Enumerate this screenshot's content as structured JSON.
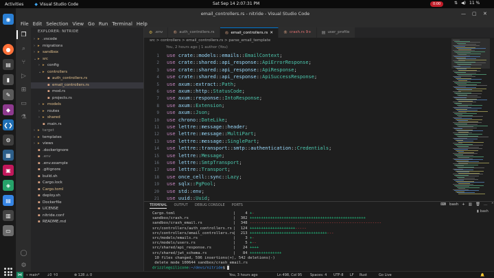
{
  "system": {
    "activities": "Activities",
    "app_name": "Visual Studio Code",
    "clock": "Sat Sep 14  2:07:31 PM",
    "record_time": "0:00",
    "battery": "11 %"
  },
  "window": {
    "title": "email_controllers.rs - nitride - Visual Studio Code"
  },
  "menu": [
    "File",
    "Edit",
    "Selection",
    "View",
    "Go",
    "Run",
    "Terminal",
    "Help"
  ],
  "sidebar": {
    "header": "EXPLORER: NITRIDE",
    "tree": [
      {
        "label": ".vscode",
        "depth": 1,
        "kind": "folder",
        "open": false,
        "color": "normal",
        "badge": ""
      },
      {
        "label": "migrations",
        "depth": 1,
        "kind": "folder",
        "open": false,
        "color": "normal",
        "badge": ""
      },
      {
        "label": "sandbox",
        "depth": 1,
        "kind": "folder",
        "open": false,
        "color": "mod",
        "badge": ""
      },
      {
        "label": "src",
        "depth": 1,
        "kind": "folder",
        "open": true,
        "color": "mod",
        "badge": ""
      },
      {
        "label": "config",
        "depth": 2,
        "kind": "folder",
        "open": false,
        "color": "normal",
        "badge": ""
      },
      {
        "label": "controllers",
        "depth": 2,
        "kind": "folder",
        "open": true,
        "color": "mod",
        "badge": ""
      },
      {
        "label": "auth_controllers.rs",
        "depth": 3,
        "kind": "file",
        "color": "mod",
        "badge": ""
      },
      {
        "label": "email_controllers.rs",
        "depth": 3,
        "kind": "file",
        "color": "mod",
        "badge": "",
        "selected": true
      },
      {
        "label": "mod.rs",
        "depth": 3,
        "kind": "file",
        "color": "normal",
        "badge": ""
      },
      {
        "label": "projects.rs",
        "depth": 3,
        "kind": "file",
        "color": "normal",
        "badge": ""
      },
      {
        "label": "models",
        "depth": 2,
        "kind": "folder",
        "open": false,
        "color": "mod",
        "badge": ""
      },
      {
        "label": "routes",
        "depth": 2,
        "kind": "folder",
        "open": false,
        "color": "normal",
        "badge": ""
      },
      {
        "label": "shared",
        "depth": 2,
        "kind": "folder",
        "open": false,
        "color": "mod",
        "badge": ""
      },
      {
        "label": "main.rs",
        "depth": 2,
        "kind": "file",
        "color": "normal",
        "badge": ""
      },
      {
        "label": "target",
        "depth": 1,
        "kind": "folder",
        "open": false,
        "color": "dim",
        "badge": ""
      },
      {
        "label": "templates",
        "depth": 1,
        "kind": "folder",
        "open": false,
        "color": "normal",
        "badge": ""
      },
      {
        "label": "views",
        "depth": 1,
        "kind": "folder",
        "open": false,
        "color": "normal",
        "badge": ""
      },
      {
        "label": ".dockerignore",
        "depth": 1,
        "kind": "file",
        "color": "normal",
        "badge": ""
      },
      {
        "label": ".env",
        "depth": 1,
        "kind": "file",
        "color": "dim",
        "badge": ""
      },
      {
        "label": ".env.example",
        "depth": 1,
        "kind": "file",
        "color": "normal",
        "badge": ""
      },
      {
        "label": ".gitignore",
        "depth": 1,
        "kind": "file",
        "color": "normal",
        "badge": ""
      },
      {
        "label": "build.sh",
        "depth": 1,
        "kind": "file",
        "color": "normal",
        "badge": ""
      },
      {
        "label": "Cargo.lock",
        "depth": 1,
        "kind": "file",
        "color": "normal",
        "badge": ""
      },
      {
        "label": "Cargo.toml",
        "depth": 1,
        "kind": "file",
        "color": "mod",
        "badge": ""
      },
      {
        "label": "deploy.sh",
        "depth": 1,
        "kind": "file",
        "color": "normal",
        "badge": ""
      },
      {
        "label": "Dockerfile",
        "depth": 1,
        "kind": "file",
        "color": "normal",
        "badge": ""
      },
      {
        "label": "LICENSE",
        "depth": 1,
        "kind": "file",
        "color": "normal",
        "badge": ""
      },
      {
        "label": "nitride.conf",
        "depth": 1,
        "kind": "file",
        "color": "normal",
        "badge": ""
      },
      {
        "label": "README.md",
        "depth": 1,
        "kind": "file",
        "color": "normal",
        "badge": ""
      }
    ]
  },
  "tabs": [
    {
      "label": ".env",
      "active": false
    },
    {
      "label": "auth_controllers.rs",
      "active": false
    },
    {
      "label": "email_controllers.rs",
      "active": true
    },
    {
      "label": "crash.rs 9+",
      "active": false
    },
    {
      "label": "user_profile",
      "active": false
    }
  ],
  "breadcrumb": "src > controllers > email_controllers.rs > parse_email_template",
  "blame": "You, 2 hours ago | 1 author (You)",
  "code": [
    [
      [
        "kw",
        "use "
      ],
      [
        "path",
        "crate"
      ],
      [
        "",
        "::"
      ],
      [
        "path",
        "models"
      ],
      [
        "",
        "::"
      ],
      [
        "path",
        "emails"
      ],
      [
        "",
        "::"
      ],
      [
        "id",
        "EmailContext"
      ],
      [
        "",
        ";"
      ]
    ],
    [
      [
        "kw",
        "use "
      ],
      [
        "path",
        "crate"
      ],
      [
        "",
        "::"
      ],
      [
        "path",
        "shared"
      ],
      [
        "",
        "::"
      ],
      [
        "path",
        "api_response"
      ],
      [
        "",
        "::"
      ],
      [
        "id",
        "ApiErrorResponse"
      ],
      [
        "",
        ";"
      ]
    ],
    [
      [
        "kw",
        "use "
      ],
      [
        "path",
        "crate"
      ],
      [
        "",
        "::"
      ],
      [
        "path",
        "shared"
      ],
      [
        "",
        "::"
      ],
      [
        "path",
        "api_response"
      ],
      [
        "",
        "::"
      ],
      [
        "id",
        "ApiResponse"
      ],
      [
        "",
        ";"
      ]
    ],
    [
      [
        "kw",
        "use "
      ],
      [
        "path",
        "crate"
      ],
      [
        "",
        "::"
      ],
      [
        "path",
        "shared"
      ],
      [
        "",
        "::"
      ],
      [
        "path",
        "api_response"
      ],
      [
        "",
        "::"
      ],
      [
        "id",
        "ApiSuccessResponse"
      ],
      [
        "",
        ";"
      ]
    ],
    [
      [
        "kw",
        "use "
      ],
      [
        "path",
        "axum"
      ],
      [
        "",
        "::"
      ],
      [
        "path",
        "extract"
      ],
      [
        "",
        "::"
      ],
      [
        "id",
        "Path"
      ],
      [
        "",
        ";"
      ]
    ],
    [
      [
        "kw",
        "use "
      ],
      [
        "path",
        "axum"
      ],
      [
        "",
        "::"
      ],
      [
        "path",
        "http"
      ],
      [
        "",
        "::"
      ],
      [
        "id",
        "StatusCode"
      ],
      [
        "",
        ";"
      ]
    ],
    [
      [
        "kw",
        "use "
      ],
      [
        "path",
        "axum"
      ],
      [
        "",
        "::"
      ],
      [
        "path",
        "response"
      ],
      [
        "",
        "::"
      ],
      [
        "id",
        "IntoResponse"
      ],
      [
        "",
        ";"
      ]
    ],
    [
      [
        "kw",
        "use "
      ],
      [
        "path",
        "axum"
      ],
      [
        "",
        "::"
      ],
      [
        "id",
        "Extension"
      ],
      [
        "",
        ";"
      ]
    ],
    [
      [
        "kw",
        "use "
      ],
      [
        "path",
        "axum"
      ],
      [
        "",
        "::"
      ],
      [
        "id",
        "Json"
      ],
      [
        "",
        ";"
      ]
    ],
    [
      [
        "kw",
        "use "
      ],
      [
        "path",
        "chrono"
      ],
      [
        "",
        "::"
      ],
      [
        "id",
        "DateLike"
      ],
      [
        "",
        ";"
      ]
    ],
    [
      [
        "kw",
        "use "
      ],
      [
        "path",
        "lettre"
      ],
      [
        "",
        "::"
      ],
      [
        "path",
        "message"
      ],
      [
        "",
        "::"
      ],
      [
        "path",
        "header"
      ],
      [
        "",
        ";"
      ]
    ],
    [
      [
        "kw",
        "use "
      ],
      [
        "path",
        "lettre"
      ],
      [
        "",
        "::"
      ],
      [
        "path",
        "message"
      ],
      [
        "",
        "::"
      ],
      [
        "id",
        "MultiPart"
      ],
      [
        "",
        ";"
      ]
    ],
    [
      [
        "kw",
        "use "
      ],
      [
        "path",
        "lettre"
      ],
      [
        "",
        "::"
      ],
      [
        "path",
        "message"
      ],
      [
        "",
        "::"
      ],
      [
        "id",
        "SinglePart"
      ],
      [
        "",
        ";"
      ]
    ],
    [
      [
        "kw",
        "use "
      ],
      [
        "path",
        "lettre"
      ],
      [
        "",
        "::"
      ],
      [
        "path",
        "transport"
      ],
      [
        "",
        "::"
      ],
      [
        "path",
        "smtp"
      ],
      [
        "",
        "::"
      ],
      [
        "path",
        "authentication"
      ],
      [
        "",
        "::"
      ],
      [
        "id",
        "Credentials"
      ],
      [
        "",
        ";"
      ]
    ],
    [
      [
        "kw",
        "use "
      ],
      [
        "path",
        "lettre"
      ],
      [
        "",
        "::"
      ],
      [
        "id",
        "Message"
      ],
      [
        "",
        ";"
      ]
    ],
    [
      [
        "kw",
        "use "
      ],
      [
        "path",
        "lettre"
      ],
      [
        "",
        "::"
      ],
      [
        "id",
        "SmtpTransport"
      ],
      [
        "",
        ";"
      ]
    ],
    [
      [
        "kw",
        "use "
      ],
      [
        "path",
        "lettre"
      ],
      [
        "",
        "::"
      ],
      [
        "id",
        "Transport"
      ],
      [
        "",
        ";"
      ]
    ],
    [
      [
        "kw",
        "use "
      ],
      [
        "path",
        "once_cell"
      ],
      [
        "",
        "::"
      ],
      [
        "path",
        "sync"
      ],
      [
        "",
        "::"
      ],
      [
        "id",
        "Lazy"
      ],
      [
        "",
        ";"
      ]
    ],
    [
      [
        "kw",
        "use "
      ],
      [
        "path",
        "sqlx"
      ],
      [
        "",
        "::"
      ],
      [
        "id",
        "PgPool"
      ],
      [
        "",
        ";"
      ]
    ],
    [
      [
        "kw",
        "use "
      ],
      [
        "path",
        "std"
      ],
      [
        "",
        "::"
      ],
      [
        "path",
        "env"
      ],
      [
        "",
        ";"
      ]
    ],
    [
      [
        "kw",
        "use "
      ],
      [
        "path",
        "uuid"
      ],
      [
        "",
        "::"
      ],
      [
        "id",
        "Uuid"
      ],
      [
        "",
        ";"
      ]
    ]
  ],
  "panel": {
    "tabs": [
      "TERMINAL",
      "OUTPUT",
      "DEBUG CONSOLE",
      "PORTS"
    ],
    "active_tab": "TERMINAL",
    "shell": "bash",
    "terminal": [
      {
        "file": "Cargo.toml",
        "count": "4",
        "plus": "+",
        "minus": "-"
      },
      {
        "file": "sandbox/crash.rs",
        "count": "302",
        "plus": "+++++++++++++++++++++++++++++++++++++++++++++++++++",
        "minus": ""
      },
      {
        "file": "sandbox/crash_email.rs",
        "count": "348",
        "plus": "",
        "minus": "----------------------------------------------------------"
      },
      {
        "file": "src/controllers/auth_controllers.rs",
        "count": "124",
        "plus": "++++++++++++++++++++",
        "minus": "-----"
      },
      {
        "file": "src/controllers/email_controllers.rs",
        "count": "213",
        "plus": "++++++++++++++++++++++++++++++++++",
        "minus": "---"
      },
      {
        "file": "src/models/emails.rs",
        "count": "3",
        "plus": "+",
        "minus": "-"
      },
      {
        "file": "src/models/users.rs",
        "count": "5",
        "plus": "+",
        "minus": "--"
      },
      {
        "file": "src/shared/api_response.rs",
        "count": "24",
        "plus": "++++",
        "minus": ""
      },
      {
        "file": "src/shared/jwt_schema.rs",
        "count": "84",
        "plus": "++++++++++++++",
        "minus": ""
      }
    ],
    "summary": " 10 files changed, 596 insertions(+), 542 deletions(-)",
    "delete_line": " delete mode 100644 sandbox/crash_email.rs",
    "prompt_user": "drizzle@silicone",
    "prompt_path": ":~/devs/nitride",
    "prompt_end": "$ "
  },
  "statusbar": {
    "branch": "main*",
    "sync": "↓0 ↑0",
    "problems": "⊗ 128  ⚠ 0",
    "blame": "You, 3 hours ago",
    "position": "Ln 498, Col 95",
    "spaces": "Spaces: 4",
    "encoding": "UTF-8",
    "eol": "LF",
    "language": "Rust",
    "golive": "Go Live"
  },
  "colors": {
    "accent": "#0078d4",
    "remote": "#16825d",
    "git_modified": "#e2c08d"
  }
}
